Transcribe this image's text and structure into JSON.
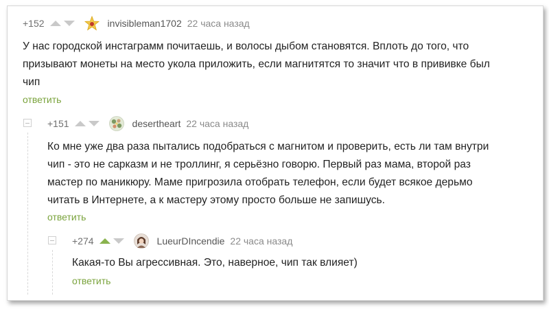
{
  "comments": [
    {
      "rating": "+152",
      "username": "invisibleman1702",
      "timestamp": "22 часа назад",
      "avatar_icon": "star-avatar-icon",
      "lines": [
        "У нас городской инстаграмм почитаешь, и волосы дыбом становятся. Вплоть до того, что",
        "призывают монеты на место укола приложить, если магнитятся то значит что в прививке был",
        "чип"
      ],
      "reply_label": "ответить"
    },
    {
      "rating": "+151",
      "username": "desertheart",
      "timestamp": "22 часа назад",
      "avatar_icon": "flower-avatar-icon",
      "lines": [
        "Ко мне уже два раза пытались подобраться с магнитом и проверить, есть ли там внутри",
        "чип - это не сарказм и не троллинг, я серьёзно говорю. Первый раз мама, второй раз",
        "мастер по маникюру. Маме пригрозила отобрать телефон, если будет всякое дерьмо",
        "читать в Интернете, а к мастеру этому просто больше не запишусь."
      ],
      "reply_label": "ответить"
    },
    {
      "rating": "+274",
      "username": "LueurDIncendie",
      "timestamp": "22 часа назад",
      "avatar_icon": "portrait-avatar-icon",
      "upvoted": true,
      "lines": [
        "Какая-то Вы агрессивная. Это, наверное, чип так влияет)"
      ],
      "reply_label": "ответить"
    }
  ],
  "colors": {
    "reply_link": "#7aa33c",
    "upvote_active": "#8ab34e",
    "arrow_inactive": "#c9c9c9"
  }
}
